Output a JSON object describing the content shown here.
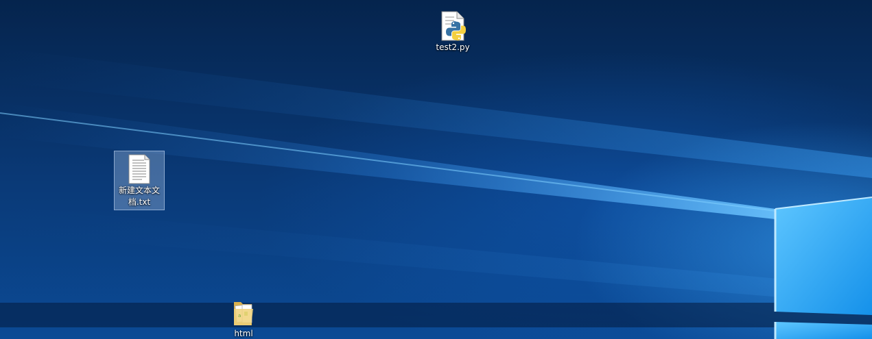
{
  "desktop": {
    "icons": [
      {
        "label": "test2.py",
        "icon": "python-file-icon"
      },
      {
        "label": "新建文本文档.txt",
        "icon": "text-file-icon",
        "selected": true
      },
      {
        "label": "html",
        "icon": "folder-icon"
      }
    ]
  },
  "colors": {
    "wallpaper_dark": "#05244d",
    "wallpaper_mid": "#0a3a78",
    "wallpaper_light": "#3aa8ff",
    "python_blue": "#3772a4",
    "python_yellow": "#f3cf3f",
    "folder_yellow": "#e8c56a"
  }
}
